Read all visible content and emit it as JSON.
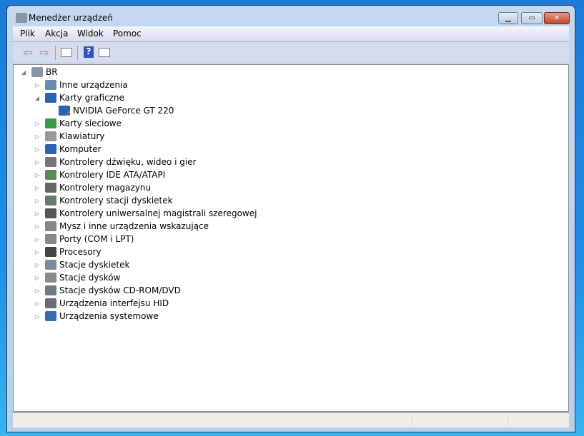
{
  "window": {
    "title": "Menedżer urządzeń"
  },
  "menu": [
    "Plik",
    "Akcja",
    "Widok",
    "Pomoc"
  ],
  "toolbar": [
    "back-icon",
    "forward-icon",
    "show-hide-console-tree-icon",
    "help-icon",
    "show-hide-action-pane-icon"
  ],
  "tree": {
    "root": "BR",
    "items": [
      {
        "label": "Inne urządzenia",
        "expanded": false
      },
      {
        "label": "Karty graficzne",
        "expanded": true,
        "children": [
          {
            "label": "NVIDIA GeForce GT 220",
            "warning": true
          }
        ]
      },
      {
        "label": "Karty sieciowe",
        "expanded": false
      },
      {
        "label": "Klawiatury",
        "expanded": false
      },
      {
        "label": "Komputer",
        "expanded": false
      },
      {
        "label": "Kontrolery dźwięku, wideo i gier",
        "expanded": false
      },
      {
        "label": "Kontrolery IDE ATA/ATAPI",
        "expanded": false
      },
      {
        "label": "Kontrolery magazynu",
        "expanded": false
      },
      {
        "label": "Kontrolery stacji dyskietek",
        "expanded": false
      },
      {
        "label": "Kontrolery uniwersalnej magistrali szeregowej",
        "expanded": false
      },
      {
        "label": "Mysz i inne urządzenia wskazujące",
        "expanded": false
      },
      {
        "label": "Porty (COM i LPT)",
        "expanded": false
      },
      {
        "label": "Procesory",
        "expanded": false
      },
      {
        "label": "Stacje dyskietek",
        "expanded": false
      },
      {
        "label": "Stacje dysków",
        "expanded": false
      },
      {
        "label": "Stacje dysków CD-ROM/DVD",
        "expanded": false
      },
      {
        "label": "Urządzenia interfejsu HID",
        "expanded": false
      },
      {
        "label": "Urządzenia systemowe",
        "expanded": false
      }
    ]
  }
}
